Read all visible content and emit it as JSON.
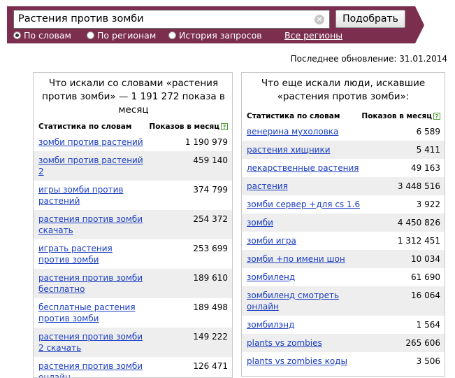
{
  "search": {
    "query": "Растения против зомби",
    "clear_symbol": "×",
    "submit_label": "Подобрать"
  },
  "modes": [
    {
      "label": "По словам",
      "checked": true
    },
    {
      "label": "По регионам",
      "checked": false
    },
    {
      "label": "История запросов",
      "checked": false
    }
  ],
  "regions_link": "Все регионы",
  "last_update": "Последнее обновление: 31.01.2014",
  "left_panel": {
    "title": "Что искали со словами «растения против зомби» — 1 191 272 показа в месяц",
    "col_keyword": "Статистика по словам",
    "col_count": "Показов в месяц",
    "help_symbol": "?",
    "rows": [
      {
        "keyword": "зомби против растений",
        "count": "1 190 979"
      },
      {
        "keyword": "зомби против растений 2",
        "count": "459 140"
      },
      {
        "keyword": "игры зомби против растений",
        "count": "374 799"
      },
      {
        "keyword": "растения против зомби скачать",
        "count": "254 372"
      },
      {
        "keyword": "играть растения против зомби",
        "count": "253 699"
      },
      {
        "keyword": "растения против зомби бесплатно",
        "count": "189 610"
      },
      {
        "keyword": "бесплатные растения против зомби",
        "count": "189 498"
      },
      {
        "keyword": "растения против зомби 2 скачать",
        "count": "149 222"
      },
      {
        "keyword": "растения против зомби онлайн",
        "count": "126 471"
      }
    ]
  },
  "right_panel": {
    "title": "Что еще искали люди, искавшие «растения против зомби»:",
    "col_keyword": "Статистика по словам",
    "col_count": "Показов в месяц",
    "help_symbol": "?",
    "rows": [
      {
        "keyword": "венерина мухоловка",
        "count": "6 589"
      },
      {
        "keyword": "растения хищники",
        "count": "5 411"
      },
      {
        "keyword": "лекарственные растения",
        "count": "49 163"
      },
      {
        "keyword": "растения",
        "count": "3 448 516"
      },
      {
        "keyword": "зомби сервер +для cs 1.6",
        "count": "3 922"
      },
      {
        "keyword": "зомби",
        "count": "4 450 826"
      },
      {
        "keyword": "зомби игра",
        "count": "1 312 451"
      },
      {
        "keyword": "зомби +по имени шон",
        "count": "10 034"
      },
      {
        "keyword": "зомбиленд",
        "count": "61 690"
      },
      {
        "keyword": "зомбиленд смотреть онлайн",
        "count": "16 064"
      },
      {
        "keyword": "зомбилэнд",
        "count": "1 564"
      },
      {
        "keyword": "plants vs zombies",
        "count": "265 606"
      },
      {
        "keyword": "plants vs zombies коды",
        "count": "3 506"
      }
    ]
  },
  "colors": {
    "topbar": "#7b2e4e",
    "link": "#1a3dc1",
    "row_alt": "#eeeeee",
    "help_green": "#4a9b32"
  }
}
